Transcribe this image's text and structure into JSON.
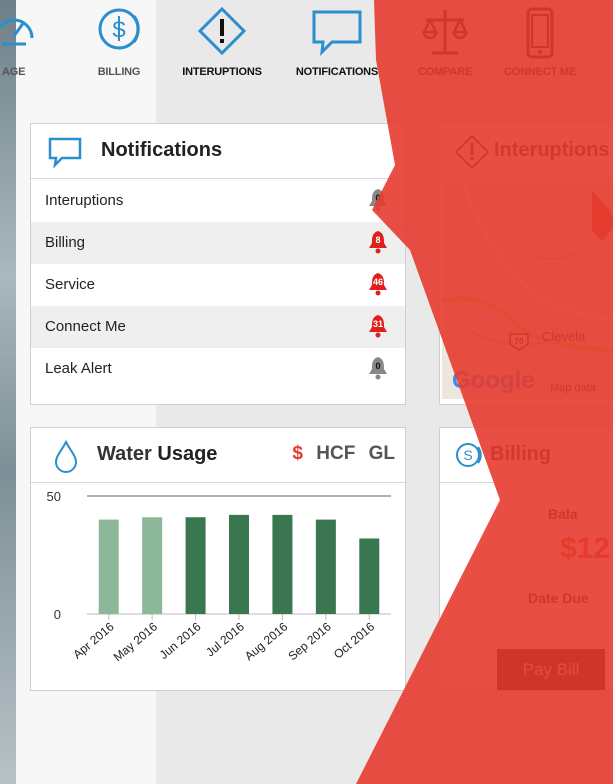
{
  "nav": {
    "items": [
      {
        "label": "AGE",
        "icon": "gauge-icon"
      },
      {
        "label": "BILLING",
        "icon": "dollar-circle-icon"
      },
      {
        "label": "INTERUPTIONS",
        "icon": "alert-diamond-icon"
      },
      {
        "label": "NOTIFICATIONS",
        "icon": "chat-bubble-icon"
      },
      {
        "label": "COMPARE",
        "icon": "balance-scale-icon"
      },
      {
        "label": "CONNECT ME",
        "icon": "mobile-phone-icon"
      }
    ]
  },
  "notifications": {
    "title": "Notifications",
    "rows": [
      {
        "label": "Interuptions",
        "count": "0"
      },
      {
        "label": "Billing",
        "count": "8"
      },
      {
        "label": "Service",
        "count": "46"
      },
      {
        "label": "Connect Me",
        "count": "31"
      },
      {
        "label": "Leak Alert",
        "count": "0"
      }
    ]
  },
  "interruptions": {
    "title": "Interuptions",
    "map_city": "Clevela",
    "map_brand": "Google",
    "map_attribution": "Map data",
    "route_shield": "70"
  },
  "usage": {
    "title_part1": "Water",
    "title_part2": "Usage",
    "unit_dollar": "$",
    "unit_hcf": "HCF",
    "unit_gl": "GL"
  },
  "billing": {
    "title": "Billing",
    "balance_label": "Bala",
    "balance_value": "$12",
    "due_label": "Date Due",
    "pay_button": "Pay Bill"
  },
  "colors": {
    "accent_red": "#e53b2f",
    "bar_light": "#8cb899",
    "bar_dark": "#3a7751",
    "nav_blue": "#2a8fcd"
  },
  "chart_data": {
    "type": "bar",
    "categories": [
      "Apr 2016",
      "May 2016",
      "Jun 2016",
      "Jul 2016",
      "Aug 2016",
      "Sep 2016",
      "Oct 2016"
    ],
    "values": [
      40,
      41,
      41,
      42,
      42,
      40,
      32
    ],
    "yticks": [
      0,
      50
    ],
    "ylim": [
      0,
      50
    ]
  }
}
